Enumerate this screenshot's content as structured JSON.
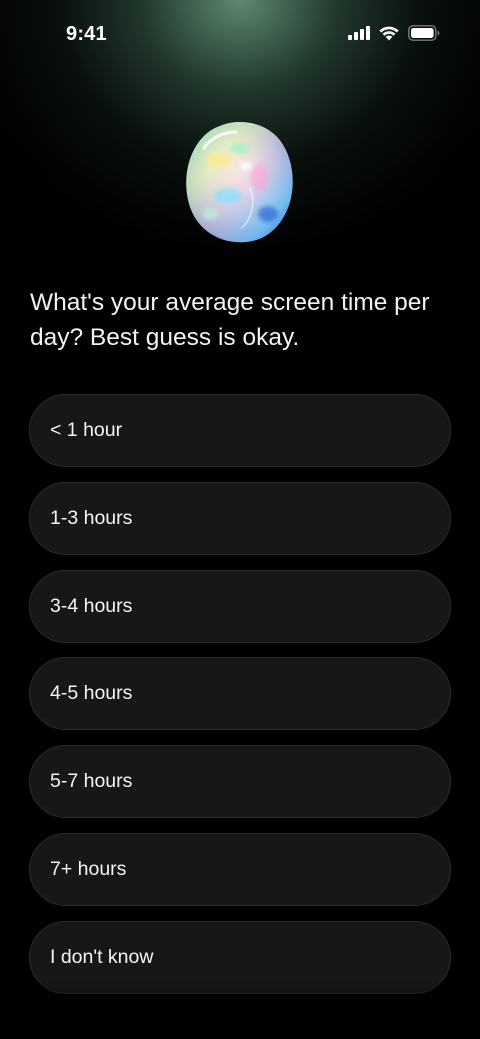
{
  "status_bar": {
    "time": "9:41",
    "icons": [
      "signal-icon",
      "wifi-icon",
      "battery-icon"
    ]
  },
  "hero": {
    "icon": "opal-gem-icon"
  },
  "question": "What's your average screen time per day? Best guess is okay.",
  "options": [
    {
      "label": "< 1 hour"
    },
    {
      "label": "1-3 hours"
    },
    {
      "label": "3-4 hours"
    },
    {
      "label": "4-5 hours"
    },
    {
      "label": "5-7 hours"
    },
    {
      "label": "7+ hours"
    },
    {
      "label": "I don't know"
    }
  ],
  "colors": {
    "background": "#000000",
    "glow": "#6ea082",
    "option_background": "#171717",
    "option_border": "#2a2a2a",
    "text": "#ffffff"
  }
}
